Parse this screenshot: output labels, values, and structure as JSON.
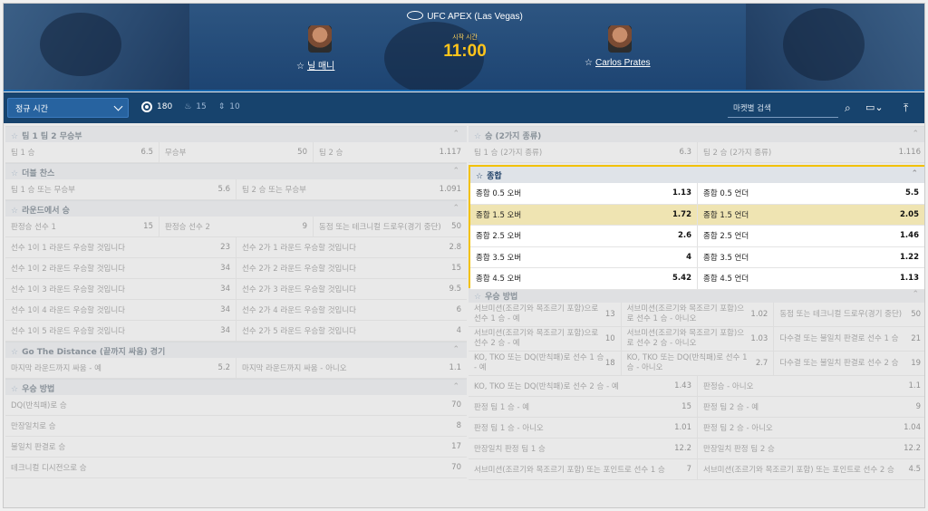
{
  "header": {
    "event_title": "UFC APEX (Las Vegas)",
    "start_label": "시작 시간",
    "start_time": "11:00",
    "fighter_left": "닐 매니",
    "fighter_right": "Carlos Prates"
  },
  "toolbar": {
    "period_select": "정규 시간",
    "count_all": "180",
    "count_live": "15",
    "count_sort": "10",
    "search_placeholder": "마켓별 검색"
  },
  "left": [
    {
      "title": "팀 1 팀 2 무승부",
      "rows": [
        [
          [
            "팀 1 승",
            "6.5"
          ],
          [
            "무승부",
            "50"
          ],
          [
            "팀 2 승",
            "1.117"
          ]
        ]
      ]
    },
    {
      "title": "더블 찬스",
      "rows": [
        [
          [
            "팀 1 승 또는 무승부",
            "5.6"
          ],
          [
            "팀 2 승 또는 무승부",
            "1.091"
          ]
        ]
      ]
    },
    {
      "title": "라운드에서 승",
      "rows": [
        [
          [
            "판정승 선수 1",
            "15"
          ],
          [
            "판정승 선수 2",
            "9"
          ],
          [
            "동점 또는 테크니컬 드로우(경기 중단)",
            "50"
          ]
        ],
        [
          [
            "선수 1이 1 라운드 우승할 것입니다",
            "23"
          ],
          [
            "선수 2가 1 라운드 우승할 것입니다",
            "2.8"
          ]
        ],
        [
          [
            "선수 1이 2 라운드 우승할 것입니다",
            "34"
          ],
          [
            "선수 2가 2 라운드 우승할 것입니다",
            "15"
          ]
        ],
        [
          [
            "선수 1이 3 라운드 우승할 것입니다",
            "34"
          ],
          [
            "선수 2가 3 라운드 우승할 것입니다",
            "9.5"
          ]
        ],
        [
          [
            "선수 1이 4 라운드 우승할 것입니다",
            "34"
          ],
          [
            "선수 2가 4 라운드 우승할 것입니다",
            "6"
          ]
        ],
        [
          [
            "선수 1이 5 라운드 우승할 것입니다",
            "34"
          ],
          [
            "선수 2가 5 라운드 우승할 것입니다",
            "4"
          ]
        ]
      ]
    },
    {
      "title": "Go The Distance (끝까지 싸움) 경기",
      "rows": [
        [
          [
            "마지막 라운드까지 싸움 - 예",
            "5.2"
          ],
          [
            "마지막 라운드까지 싸움 - 아니오",
            "1.1"
          ]
        ]
      ]
    },
    {
      "title": "우승 방법",
      "rows": [
        [
          [
            "DQ(반칙패)로 승",
            "70"
          ]
        ],
        [
          [
            "만장일치로 승",
            "8"
          ]
        ],
        [
          [
            "불일치 판결로 승",
            "17"
          ]
        ],
        [
          [
            "테크니컬 디시전으로 승",
            "70"
          ]
        ]
      ]
    }
  ],
  "right_top": {
    "title": "승 (2가지 종류)",
    "rows": [
      [
        [
          "팀 1 승 (2가지 종류)",
          "6.3"
        ],
        [
          "팀 2 승 (2가지 종류)",
          "1.116"
        ]
      ]
    ]
  },
  "totals": {
    "title": "종합",
    "rows": [
      [
        [
          "종합 0.5 오버",
          "1.13"
        ],
        [
          "종합 0.5 언더",
          "5.5"
        ]
      ],
      [
        [
          "종합 1.5 오버",
          "1.72"
        ],
        [
          "종합 1.5 언더",
          "2.05"
        ]
      ],
      [
        [
          "종합 2.5 오버",
          "2.6"
        ],
        [
          "종합 2.5 언더",
          "1.46"
        ]
      ],
      [
        [
          "종합 3.5 오버",
          "4"
        ],
        [
          "종합 3.5 언더",
          "1.22"
        ]
      ],
      [
        [
          "종합 4.5 오버",
          "5.42"
        ],
        [
          "종합 4.5 언더",
          "1.13"
        ]
      ]
    ]
  },
  "right_bottom": {
    "title": "우승 방법",
    "rows": [
      [
        [
          "서브미션(조르기와 목조르기 포함)으로 선수 1 승 - 예",
          "13"
        ],
        [
          "서브미션(조르기와 목조르기 포함)으로 선수 1 승 - 아니오",
          "1.02"
        ],
        [
          "동점 또는 테크니컬 드로우(경기 중단)",
          "50"
        ]
      ],
      [
        [
          "서브미션(조르기와 목조르기 포함)으로 선수 2 승 - 예",
          "10"
        ],
        [
          "서브미션(조르기와 목조르기 포함)으로 선수 2 승 - 아니오",
          "1.03"
        ],
        [
          "다수결 또는 불일치 판결로 선수 1 승",
          "21"
        ]
      ],
      [
        [
          "KO, TKO 또는 DQ(반칙패)로 선수 1 승 - 예",
          "18"
        ],
        [
          "KO, TKO 또는 DQ(반칙패)로 선수 1 승 - 아니오",
          "2.7"
        ],
        [
          "다수결 또는 불일치 판결로 선수 2 승",
          "19"
        ]
      ],
      [
        [
          "KO, TKO 또는 DQ(반칙패)로 선수 2 승 - 예",
          "1.43"
        ],
        [
          "판정승 - 아니오",
          "1.1"
        ]
      ],
      [
        [
          "판정 팀 1 승 - 예",
          "15"
        ],
        [
          "판정 팀 2 승 - 예",
          "9"
        ]
      ],
      [
        [
          "판정 팀 1 승 - 아니오",
          "1.01"
        ],
        [
          "판정 팀 2 승 - 아니오",
          "1.04"
        ]
      ],
      [
        [
          "만장일치 판정 팀 1 승",
          "12.2"
        ],
        [
          "만장일치 판정 팀 2 승",
          "12.2"
        ]
      ],
      [
        [
          "서브미션(조르기와 목조르기 포함) 또는 포인트로 선수 1 승",
          "7"
        ],
        [
          "서브미션(조르기와 목조르기 포함) 또는 포인트로 선수 2 승",
          "4.5"
        ]
      ]
    ]
  }
}
